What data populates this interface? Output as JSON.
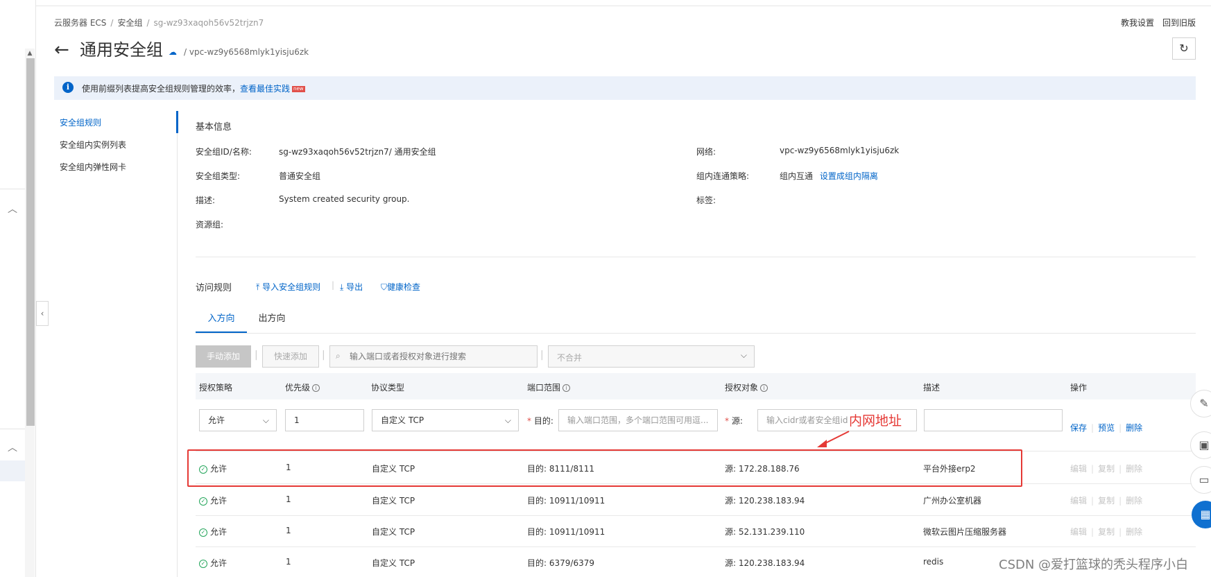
{
  "breadcrumb": {
    "ecs": "云服务器 ECS",
    "group": "安全组",
    "current": "sg-wz93xaqoh56v52trjzn7"
  },
  "top_links": {
    "guide": "教我设置",
    "old_version": "回到旧版"
  },
  "title": {
    "text": "通用安全组",
    "vpc": "/ vpc-wz9y6568mlyk1yisju6zk"
  },
  "banner": {
    "text": "使用前缀列表提高安全组规则管理的效率，",
    "link": "查看最佳实践",
    "badge": "new"
  },
  "nav": {
    "items": [
      "安全组规则",
      "安全组内实例列表",
      "安全组内弹性网卡"
    ]
  },
  "basic_info": {
    "title": "基本信息",
    "id_label": "安全组ID/名称:",
    "id_value": "sg-wz93xaqoh56v52trjzn7/ 通用安全组",
    "type_label": "安全组类型:",
    "type_value": "普通安全组",
    "desc_label": "描述:",
    "desc_value": "System created security group.",
    "rg_label": "资源组:",
    "network_label": "网络:",
    "network_value": "vpc-wz9y6568mlyk1yisju6zk",
    "policy_label": "组内连通策略:",
    "policy_value": "组内互通",
    "policy_link": "设置成组内隔离",
    "tag_label": "标签:"
  },
  "rules_toolbar": {
    "title": "访问规则",
    "import": "导入安全组规则",
    "export": "导出",
    "health": "健康检查"
  },
  "tabs": {
    "inbound": "入方向",
    "outbound": "出方向"
  },
  "actions": {
    "manual_add": "手动添加",
    "quick_add": "快速添加",
    "search_placeholder": "输入端口或者授权对象进行搜索",
    "merge": "不合并"
  },
  "table": {
    "headers": {
      "policy": "授权策略",
      "priority": "优先级",
      "protocol": "协议类型",
      "port": "端口范围",
      "target": "授权对象",
      "desc": "描述",
      "ops": "操作"
    }
  },
  "add_row": {
    "policy": "允许",
    "priority": "1",
    "protocol": "自定义 TCP",
    "dest_label": "目的:",
    "dest_placeholder": "输入端口范围，多个端口范围可用逗...",
    "src_label": "源:",
    "src_placeholder": "输入cidr或者安全组id",
    "desc_value": "",
    "save": "保存",
    "preview": "预览",
    "delete": "删除"
  },
  "rules": [
    {
      "policy": "允许",
      "priority": "1",
      "protocol": "自定义 TCP",
      "port": "目的: 8111/8111",
      "source": "源: 172.28.188.76",
      "desc": "平台外接erp2"
    },
    {
      "policy": "允许",
      "priority": "1",
      "protocol": "自定义 TCP",
      "port": "目的: 10911/10911",
      "source": "源: 120.238.183.94",
      "desc": "广州办公室机器"
    },
    {
      "policy": "允许",
      "priority": "1",
      "protocol": "自定义 TCP",
      "port": "目的: 10911/10911",
      "source": "源: 52.131.239.110",
      "desc": "微软云图片压缩服务器"
    },
    {
      "policy": "允许",
      "priority": "1",
      "protocol": "自定义 TCP",
      "port": "目的: 6379/6379",
      "source": "源: 120.238.183.94",
      "desc": "redis"
    }
  ],
  "row_ops": {
    "edit": "编辑",
    "copy": "复制",
    "delete": "删除"
  },
  "annotation": {
    "text": "内网地址"
  },
  "watermark": "CSDN @爱打篮球的秃头程序小白",
  "colors": {
    "accent": "#0064c8",
    "annotation": "#e53935",
    "success": "#23a55a"
  }
}
